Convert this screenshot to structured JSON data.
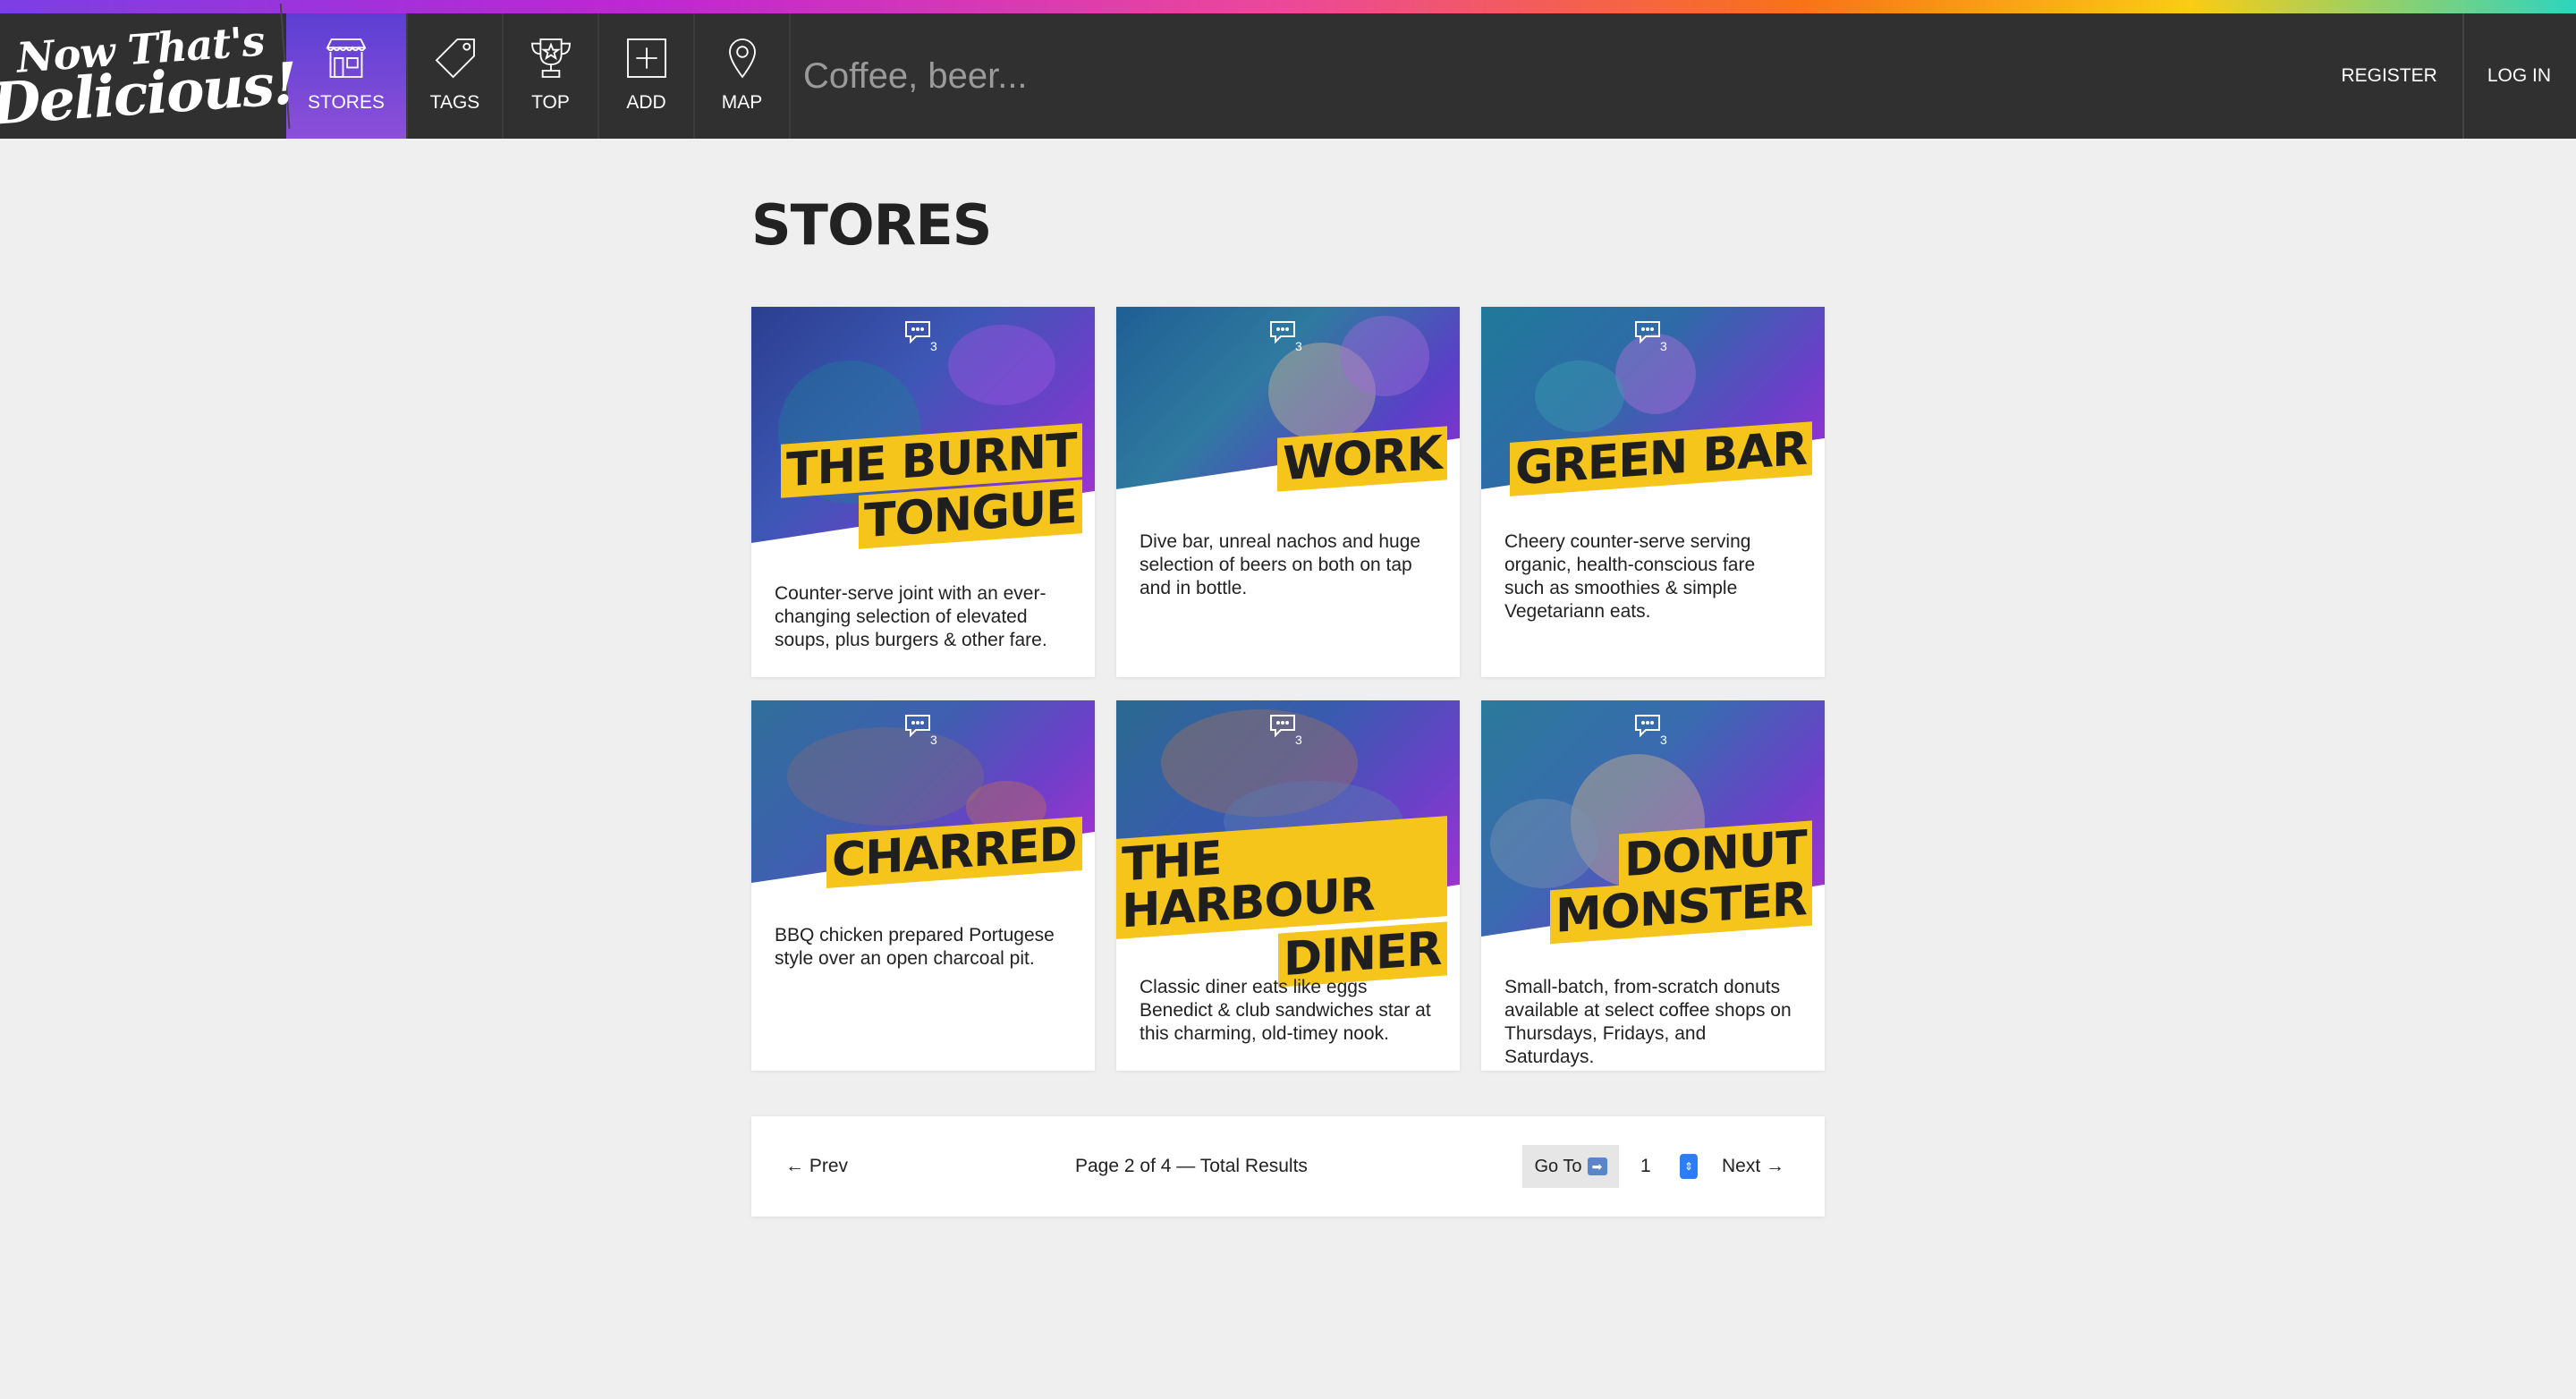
{
  "brand": {
    "line1": "Now That's",
    "line2": "Delicious!"
  },
  "nav": {
    "items": [
      {
        "label": "STORES",
        "icon": "store-icon"
      },
      {
        "label": "TAGS",
        "icon": "tag-icon"
      },
      {
        "label": "TOP",
        "icon": "trophy-icon"
      },
      {
        "label": "ADD",
        "icon": "add-icon"
      },
      {
        "label": "MAP",
        "icon": "map-pin-icon"
      }
    ],
    "search_placeholder": "Coffee, beer...",
    "register": "REGISTER",
    "login": "LOG IN"
  },
  "page": {
    "title": "STORES"
  },
  "stores": [
    {
      "name_lines": [
        "THE BURNT",
        "TONGUE"
      ],
      "comments": "3",
      "description": "Counter-serve joint with an ever-changing selection of elevated soups, plus burgers & other fare."
    },
    {
      "name_lines": [
        "WORK"
      ],
      "comments": "3",
      "description": "Dive bar, unreal nachos and huge selection of beers on both on tap and in bottle."
    },
    {
      "name_lines": [
        "GREEN BAR"
      ],
      "comments": "3",
      "description": "Cheery counter-serve serving organic, health-conscious fare such as smoothies & simple Vegetariann eats."
    },
    {
      "name_lines": [
        "CHARRED"
      ],
      "comments": "3",
      "description": "BBQ chicken prepared Portugese style over an open charcoal pit."
    },
    {
      "name_lines": [
        "THE HARBOUR",
        "DINER"
      ],
      "comments": "3",
      "description": "Classic diner eats like eggs Benedict & club sandwiches star at this charming, old-timey nook."
    },
    {
      "name_lines": [
        "DONUT",
        "MONSTER"
      ],
      "comments": "3",
      "description": "Small-batch, from-scratch donuts available at select coffee shops on Thursdays, Fridays, and Saturdays."
    }
  ],
  "pagination": {
    "prev": "← Prev",
    "info": "Page 2 of 4 — Total Results",
    "goto": "Go To",
    "page_value": "1",
    "next": "Next →"
  },
  "colors": {
    "nav_bg": "#303030",
    "active_tab": "#7b4fd8",
    "title_highlight": "#f5c51c",
    "page_bg": "#efefef"
  }
}
